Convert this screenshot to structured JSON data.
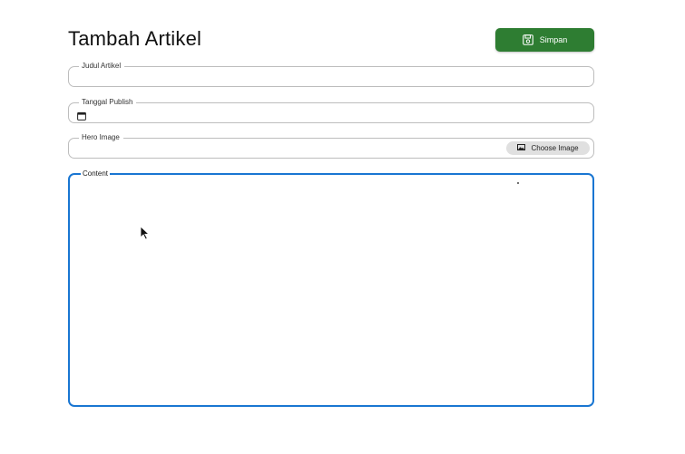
{
  "page": {
    "title": "Tambah Artikel"
  },
  "toolbar": {
    "save_label": "Simpan",
    "save_icon": "floppy-disk-icon",
    "save_color": "#2e7d32"
  },
  "form": {
    "judul": {
      "label": "Judul Artikel",
      "value": ""
    },
    "tanggal": {
      "label": "Tanggal Publish",
      "value": "",
      "icon": "calendar-icon"
    },
    "hero": {
      "label": "Hero Image",
      "button_label": "Choose Image",
      "button_icon": "image-icon"
    },
    "content": {
      "label": "Content",
      "value": "",
      "focus_color": "#1976d2"
    }
  }
}
